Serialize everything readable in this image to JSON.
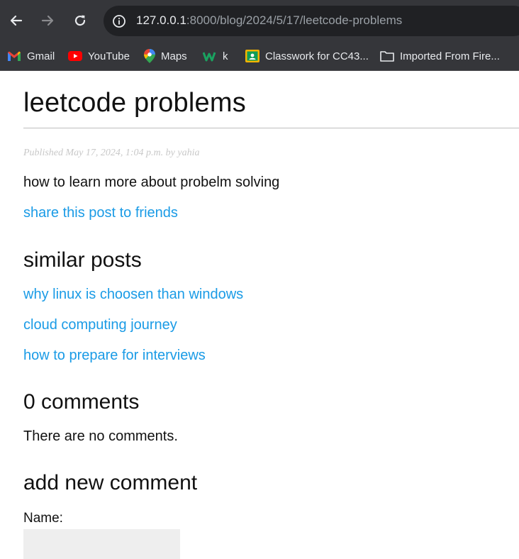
{
  "browser": {
    "url_host": "127.0.0.1",
    "url_rest": ":8000/blog/2024/5/17/leetcode-problems",
    "bookmarks": [
      {
        "label": "Gmail",
        "icon": "gmail-icon"
      },
      {
        "label": "YouTube",
        "icon": "youtube-icon"
      },
      {
        "label": "Maps",
        "icon": "maps-icon"
      },
      {
        "label": "k",
        "icon": "w-icon"
      },
      {
        "label": "Classwork for CC43...",
        "icon": "classroom-icon"
      },
      {
        "label": "Imported From Fire...",
        "icon": "folder-icon"
      }
    ]
  },
  "post": {
    "title": "leetcode problems",
    "meta": "Published May 17, 2024, 1:04 p.m. by yahia",
    "body": "how to learn more about probelm solving",
    "share_link": "share this post to friends"
  },
  "similar": {
    "heading": "similar posts",
    "items": [
      "why linux is choosen than windows",
      "cloud computing journey",
      "how to prepare for interviews"
    ]
  },
  "comments": {
    "heading": "0 comments",
    "empty_text": "There are no comments."
  },
  "form": {
    "heading": "add new comment",
    "name_label": "Name:"
  },
  "colors": {
    "link": "#1a9be6",
    "chrome": "#35363a",
    "omnibox": "#202124"
  }
}
